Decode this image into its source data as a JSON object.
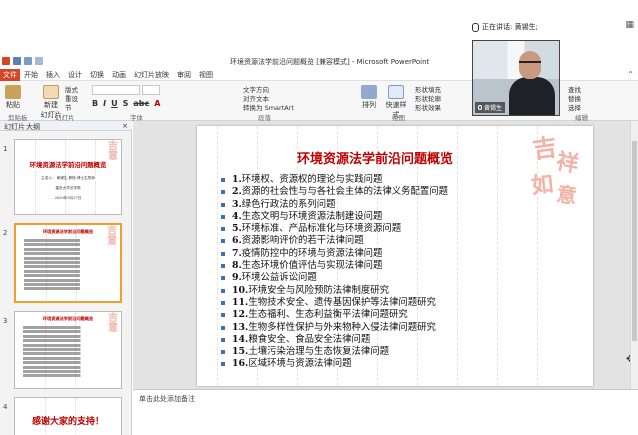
{
  "meeting": {
    "speaking_label": "正在讲话: 黄锡生;",
    "participant_name": "黄锡生"
  },
  "app": {
    "window_title": "环境资源法学前沿问题概览 [兼容模式] - Microsoft PowerPoint",
    "file_tab": "文件",
    "menu_tabs": [
      "开始",
      "插入",
      "设计",
      "切换",
      "动画",
      "幻灯片放映",
      "审阅",
      "视图"
    ]
  },
  "ribbon": {
    "paste": "粘贴",
    "new_slide": "新建\n幻灯片",
    "layout": "版式",
    "reset": "重设",
    "section": "节",
    "text_direction": "文字方向",
    "align_text": "对齐文本",
    "convert_smartart": "转换为 SmartArt",
    "arrange": "排列",
    "quick_styles": "快速样式",
    "shape_fill": "形状填充",
    "shape_outline": "形状轮廓",
    "shape_effect": "形状效果",
    "find": "查找",
    "replace": "替换",
    "select": "选择",
    "groups": {
      "clipboard": "剪贴板",
      "slides": "幻灯片",
      "font": "字体",
      "paragraph": "段落",
      "drawing": "绘图",
      "editing": "编辑"
    }
  },
  "panel": {
    "tab_slides": "幻灯片",
    "tab_outline": "大纲",
    "close": "×"
  },
  "thumbnails": [
    {
      "number": "1",
      "title": "环境资源法学前沿问题概览",
      "lines": [
        "主讲人：  黄锡生  教授  博士生导师",
        "重庆大学法学院",
        "2020年8月27日"
      ]
    },
    {
      "number": "2",
      "title": "环境资源法学前沿问题概览",
      "selected": true
    },
    {
      "number": "3",
      "title": "环境资源法学前沿问题概览"
    },
    {
      "number": "4",
      "title": "感谢大家的支持！"
    }
  ],
  "slide": {
    "title": "环境资源法学前沿问题概览",
    "deco": "吉祥如意",
    "items": [
      {
        "num": "1.",
        "text": "环境权、资源权的理论与实践问题"
      },
      {
        "num": "2.",
        "text": "资源的社会性与与各社会主体的法律义务配置问题"
      },
      {
        "num": "3.",
        "text": "绿色行政法的系列问题"
      },
      {
        "num": "4.",
        "text": "生态文明与环境资源法制建设问题"
      },
      {
        "num": "5.",
        "text": "环境标准、产品标准化与环境资源问题"
      },
      {
        "num": "6.",
        "text": "资源影响评价的若干法律问题"
      },
      {
        "num": "7.",
        "text": "疫情防控中的环境与资源法律问题"
      },
      {
        "num": "8.",
        "text": "生态环境价值评估与实现法律问题"
      },
      {
        "num": "9.",
        "text": "环境公益诉讼问题"
      },
      {
        "num": "10.",
        "text": "环境安全与风险预防法律制度研究"
      },
      {
        "num": "11.",
        "text": "生物技术安全、遗传基因保护等法律问题研究"
      },
      {
        "num": "12.",
        "text": "生态福利、生态利益衡平法律问题研究"
      },
      {
        "num": "13.",
        "text": "生物多样性保护与外来物种入侵法律问题研究"
      },
      {
        "num": "14.",
        "text": "粮食安全、食品安全法律问题"
      },
      {
        "num": "15.",
        "text": "土壤污染治理与生态恢复法律问题"
      },
      {
        "num": "16.",
        "text": "区域环境与资源法律问题"
      }
    ]
  },
  "notes": {
    "placeholder": "单击此处添加备注"
  },
  "colors": {
    "accent_red": "#c00000",
    "bullet_blue": "#3f6fb5",
    "file_tab": "#d24726",
    "selected_thumb": "#f0a030"
  }
}
